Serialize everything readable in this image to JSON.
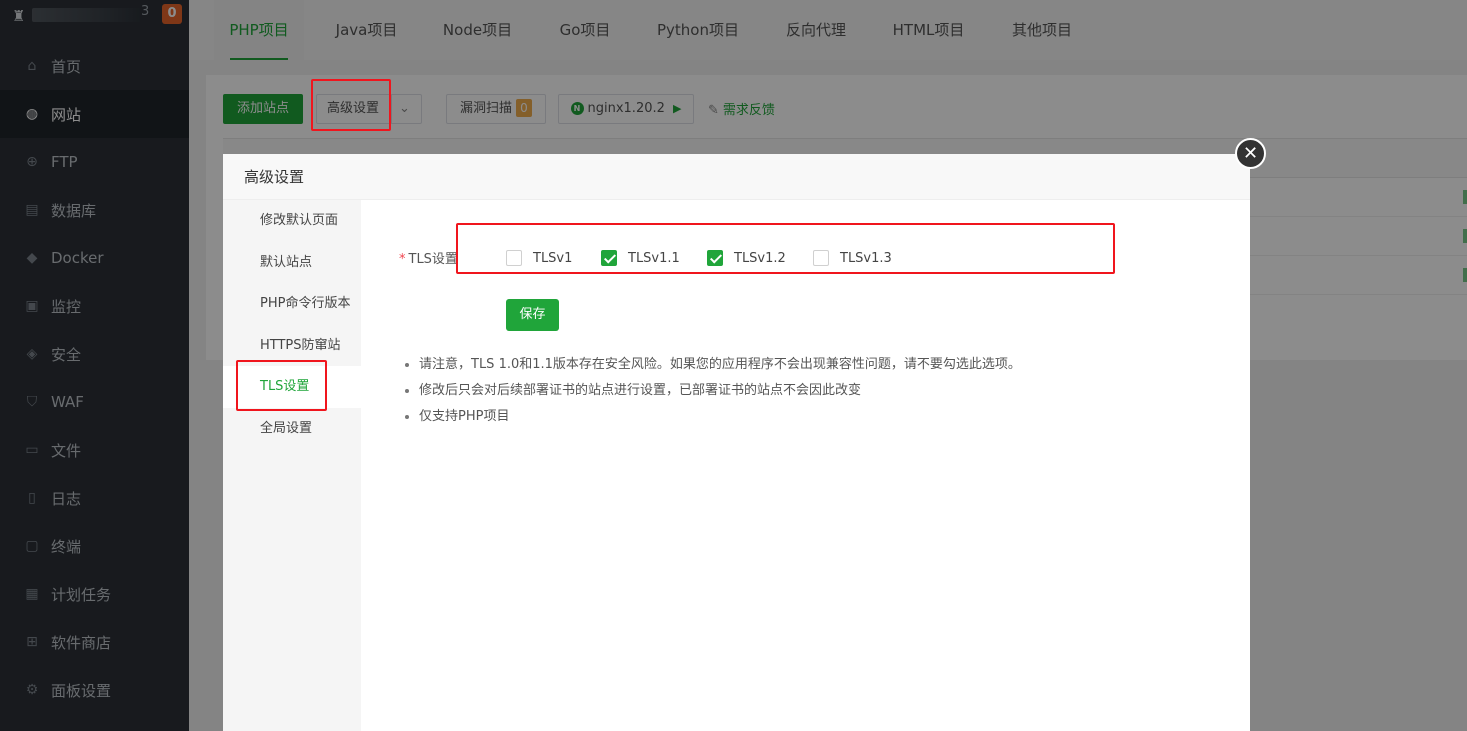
{
  "sidebar": {
    "user_tail": "3",
    "badge": "0",
    "items": [
      {
        "label": "首页",
        "icon": "home-icon"
      },
      {
        "label": "网站",
        "icon": "globe-icon"
      },
      {
        "label": "FTP",
        "icon": "ftp-icon"
      },
      {
        "label": "数据库",
        "icon": "database-icon"
      },
      {
        "label": "Docker",
        "icon": "docker-icon"
      },
      {
        "label": "监控",
        "icon": "monitor-icon"
      },
      {
        "label": "安全",
        "icon": "shield-icon"
      },
      {
        "label": "WAF",
        "icon": "waf-shield-icon"
      },
      {
        "label": "文件",
        "icon": "folder-icon"
      },
      {
        "label": "日志",
        "icon": "log-icon"
      },
      {
        "label": "终端",
        "icon": "terminal-icon"
      },
      {
        "label": "计划任务",
        "icon": "calendar-icon"
      },
      {
        "label": "软件商店",
        "icon": "apps-icon"
      },
      {
        "label": "面板设置",
        "icon": "gear-icon"
      }
    ]
  },
  "tabs": [
    "PHP项目",
    "Java项目",
    "Node项目",
    "Go项目",
    "Python项目",
    "反向代理",
    "HTML项目",
    "其他项目"
  ],
  "toolbar": {
    "add_site": "添加站点",
    "advanced": "高级设置",
    "vuln_scan": "漏洞扫描",
    "vuln_count": "0",
    "nginx": "nginx1.20.2",
    "feedback": "需求反馈"
  },
  "modal": {
    "title": "高级设置",
    "nav": [
      "修改默认页面",
      "默认站点",
      "PHP命令行版本",
      "HTTPS防窜站",
      "TLS设置",
      "全局设置"
    ],
    "form_label": "TLS设置",
    "required_mark": "*",
    "options": [
      {
        "label": "TLSv1",
        "checked": false
      },
      {
        "label": "TLSv1.1",
        "checked": true
      },
      {
        "label": "TLSv1.2",
        "checked": true
      },
      {
        "label": "TLSv1.3",
        "checked": false
      }
    ],
    "save": "保存",
    "notes": [
      "请注意，TLS 1.0和1.1版本存在安全风险。如果您的应用程序不会出现兼容性问题，请不要勾选此选项。",
      "修改后只会对后续部署证书的站点进行设置，已部署证书的站点不会因此改变",
      "仅支持PHP项目"
    ]
  },
  "colors": {
    "accent": "#20a53a",
    "highlight": "#f0151d",
    "sidebar_bg": "#2c3138"
  }
}
